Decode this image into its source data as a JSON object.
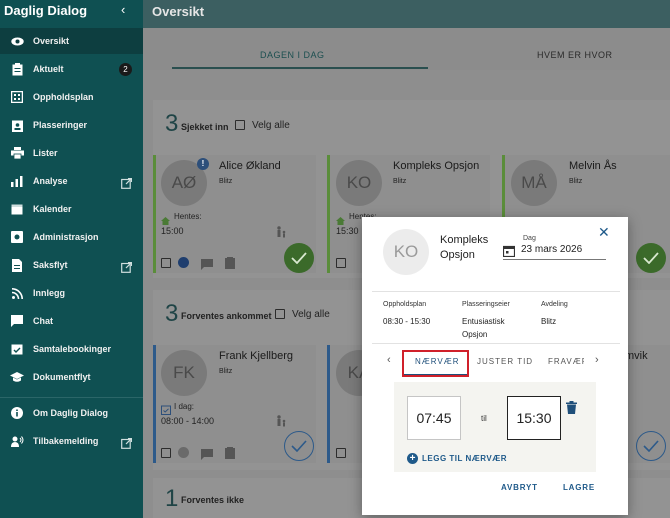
{
  "sidebar": {
    "title": "Daglig Dialog",
    "collapse_icon": "chevron-left-icon",
    "items": [
      {
        "label": "Oversikt",
        "icon": "eye-icon"
      },
      {
        "label": "Aktuelt",
        "icon": "clipboard-icon",
        "badge": "2"
      },
      {
        "label": "Oppholdsplan",
        "icon": "calendar-grid-icon"
      },
      {
        "label": "Plasseringer",
        "icon": "badge-icon"
      },
      {
        "label": "Lister",
        "icon": "printer-icon"
      },
      {
        "label": "Analyse",
        "icon": "bar-chart-icon"
      },
      {
        "label": "Kalender",
        "icon": "calendar-icon"
      },
      {
        "label": "Administrasjon",
        "icon": "admin-icon"
      },
      {
        "label": "Saksflyt",
        "icon": "document-icon"
      },
      {
        "label": "Innlegg",
        "icon": "rss-icon"
      },
      {
        "label": "Chat",
        "icon": "chat-icon"
      },
      {
        "label": "Samtalebookinger",
        "icon": "calendar-check-icon"
      },
      {
        "label": "Dokumentflyt",
        "icon": "graduation-cap-icon"
      },
      {
        "label": "Om Daglig Dialog",
        "icon": "info-icon"
      },
      {
        "label": "Tilbakemelding",
        "icon": "feedback-icon"
      }
    ]
  },
  "header": {
    "title": "Oversikt"
  },
  "tabs": [
    {
      "label": "DAGEN I DAG"
    },
    {
      "label": "HVEM ER HVOR"
    }
  ],
  "sections": {
    "checked_in": {
      "count": "3",
      "label": "Sjekket inn",
      "select_all": "Velg alle"
    },
    "expected": {
      "count": "3",
      "label": "Forventes ankommet",
      "select_all": "Velg alle"
    },
    "not_expected": {
      "count": "1",
      "label": "Forventes ikke"
    }
  },
  "cards_checked_in": [
    {
      "initials": "AØ",
      "name": "Alice Økland",
      "group": "Blitz",
      "pickup_label": "Hentes:",
      "time": "15:00"
    },
    {
      "initials": "KO",
      "name": "Kompleks Opsjon",
      "group": "Blitz",
      "pickup_label": "Hentes:",
      "time": "15:30"
    },
    {
      "initials": "MÅ",
      "name": "Melvin Ås",
      "group": "Blitz"
    }
  ],
  "cards_expected": [
    {
      "initials": "FK",
      "name": "Frank Kjellberg",
      "group": "Blitz",
      "today_label": "I dag:",
      "time": "08:00 - 14:00"
    },
    {
      "initials": "KA",
      "partial_name": "mvik"
    }
  ],
  "modal": {
    "initials": "KO",
    "name": "Kompleks Opsjon",
    "date_label": "Dag",
    "date": "23 mars 2026",
    "columns": [
      {
        "label": "Oppholdsplan",
        "value": "08:30 - 15:30"
      },
      {
        "label": "Plasseringseier",
        "value": "Entusiastisk Opsjon"
      },
      {
        "label": "Avdeling",
        "value": "Blitz"
      }
    ],
    "tabs": [
      {
        "label": "NÆRVÆR"
      },
      {
        "label": "JUSTER TID"
      },
      {
        "label": "FRAVÆR"
      }
    ],
    "attendance": {
      "from": "07:45",
      "separator": "til",
      "to": "15:30"
    },
    "add_label": "LEGG TIL NÆRVÆR",
    "cancel_label": "AVBRYT",
    "save_label": "LAGRE"
  },
  "colors": {
    "sidebar": "#0f5052",
    "accent": "#1f5a8a",
    "green": "#5a8d3a",
    "highlight": "#d0202a"
  }
}
